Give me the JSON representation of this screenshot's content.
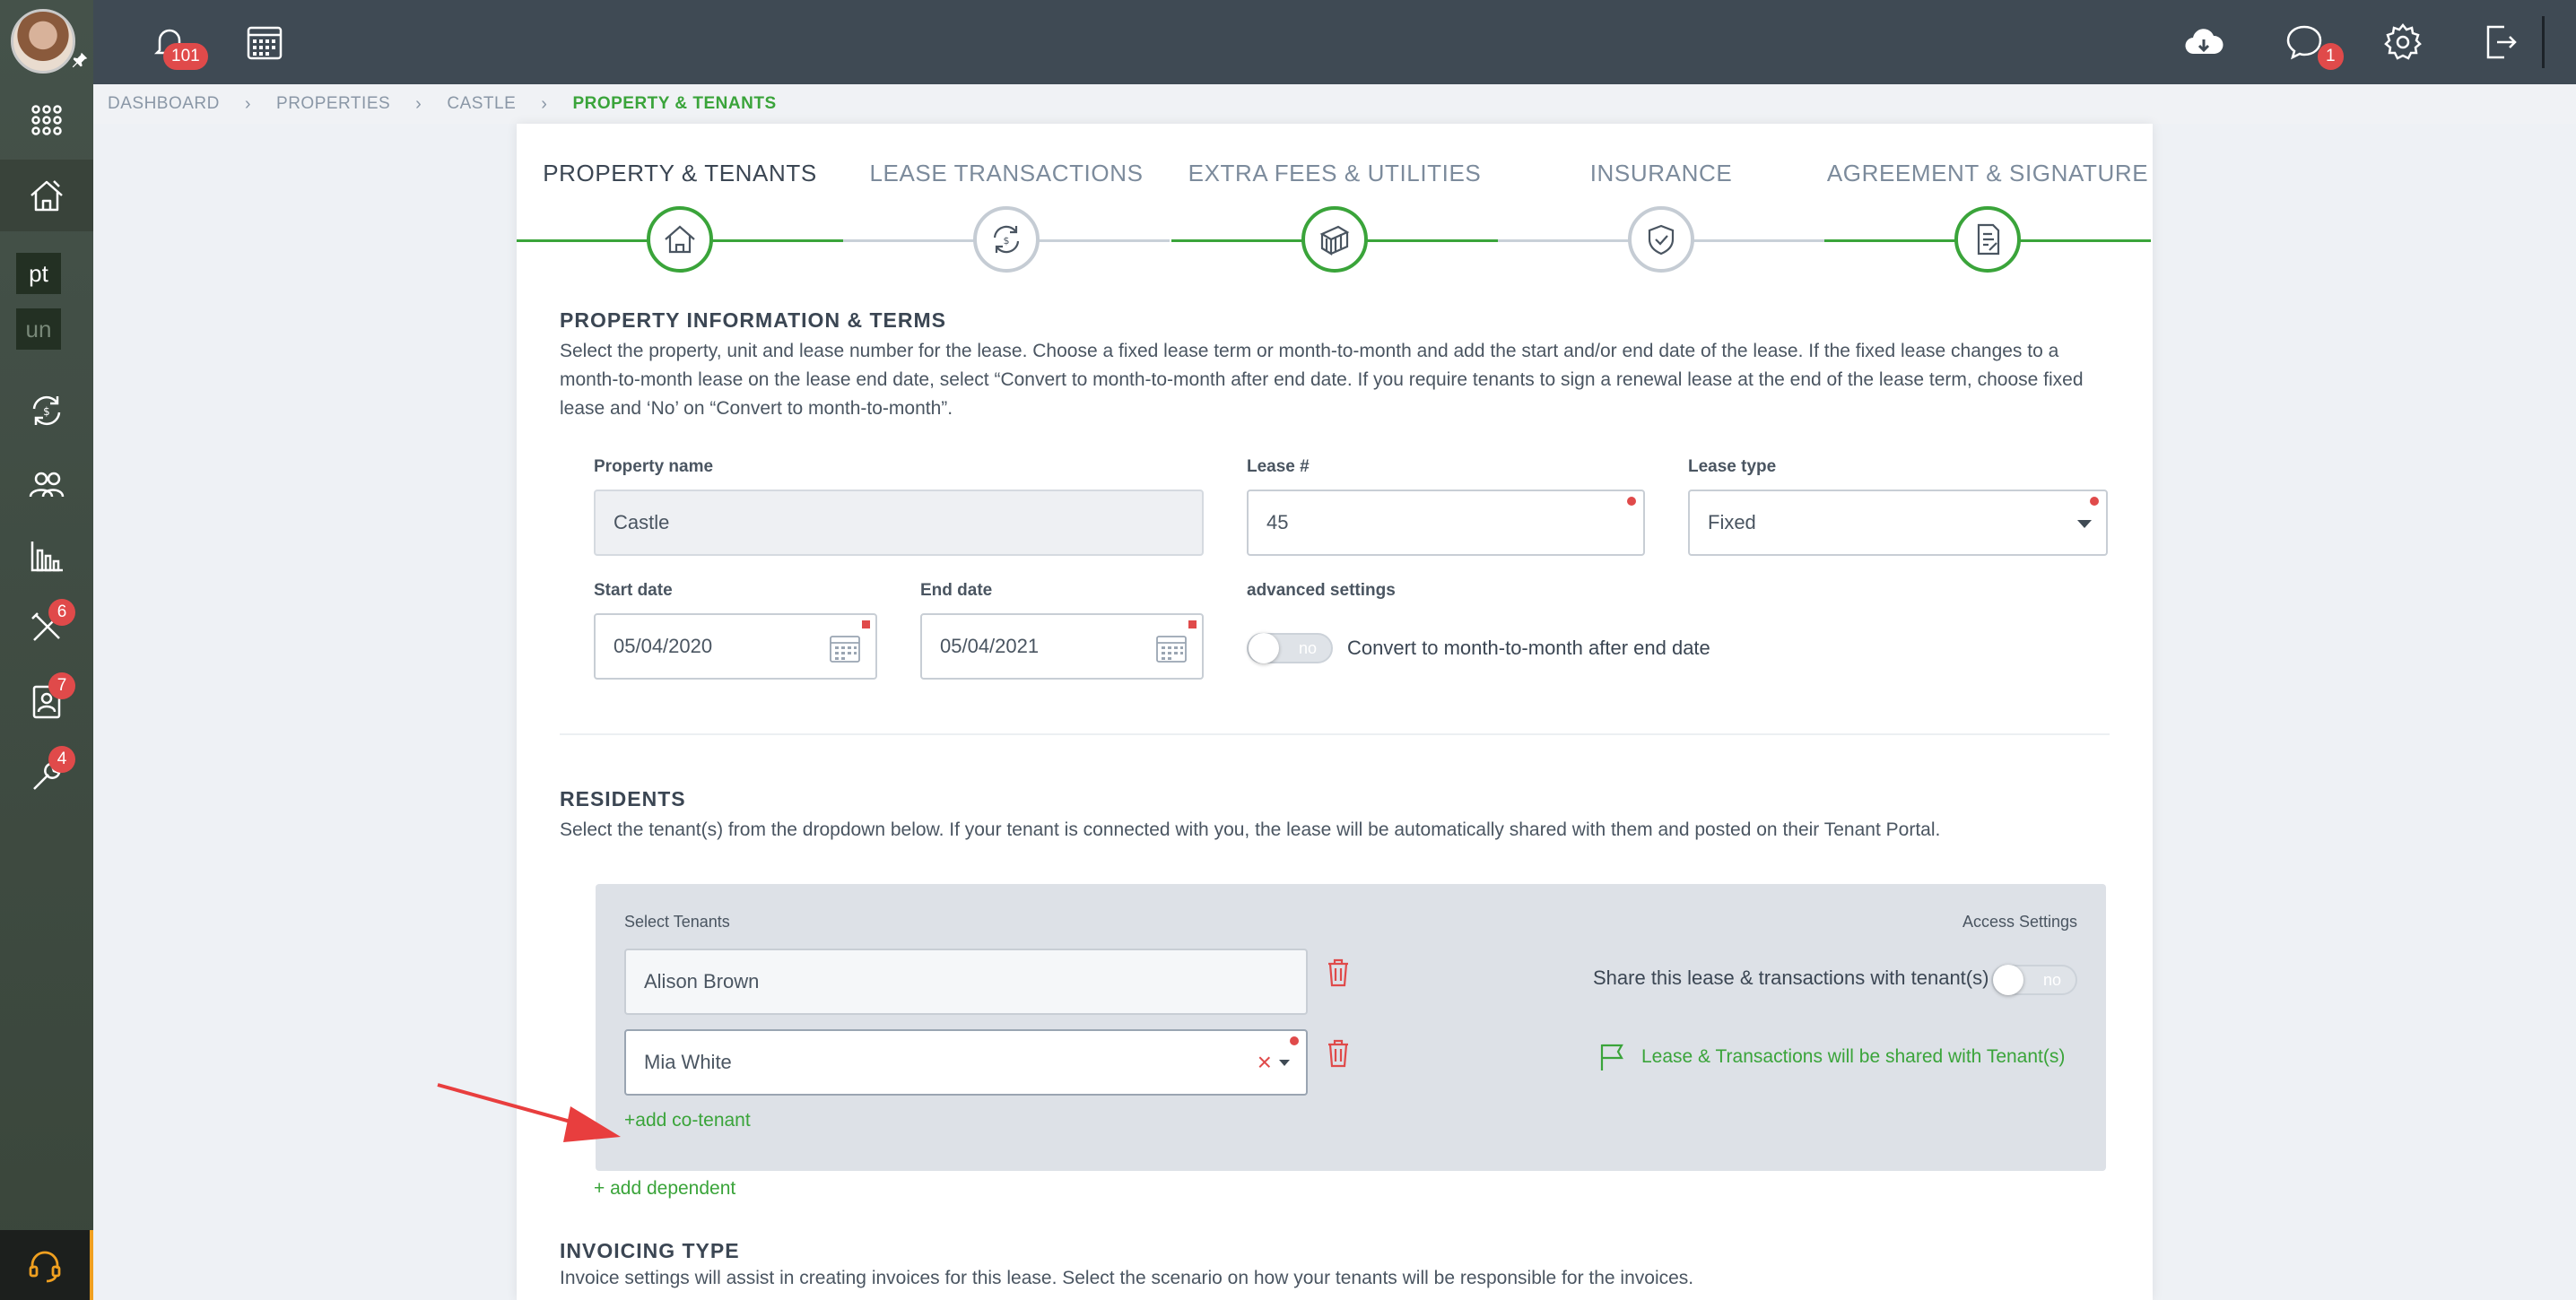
{
  "topbar": {
    "notifications_count": "101",
    "messages_count": "1"
  },
  "sidebar": {
    "chip_pt": "pt",
    "chip_un": "un",
    "badges": {
      "tools": "6",
      "contacts": "7",
      "maintenance": "4"
    }
  },
  "breadcrumb": {
    "items": [
      "DASHBOARD",
      "PROPERTIES",
      "CASTLE",
      "PROPERTY & TENANTS"
    ]
  },
  "steps": [
    {
      "label": "PROPERTY & TENANTS",
      "icon": "house-icon",
      "active": true,
      "done": true
    },
    {
      "label": "LEASE TRANSACTIONS",
      "icon": "refresh-dollar-icon",
      "active": false,
      "done": false
    },
    {
      "label": "EXTRA FEES & UTILITIES",
      "icon": "money-stack-icon",
      "active": false,
      "done": true
    },
    {
      "label": "INSURANCE",
      "icon": "shield-check-icon",
      "active": false,
      "done": false
    },
    {
      "label": "AGREEMENT & SIGNATURE",
      "icon": "document-sign-icon",
      "active": false,
      "done": true
    }
  ],
  "property_section": {
    "title": "PROPERTY INFORMATION & TERMS",
    "description": "Select the property, unit and lease number for the lease. Choose a fixed lease term or month-to-month and add the start and/or end date of the lease. If the fixed lease changes to a month-to-month lease on the lease end date, select “Convert to month-to-month after end date. If you require tenants to sign a renewal lease at the end of the lease term, choose fixed lease and ‘No’ on “Convert to month-to-month”.",
    "property_name_label": "Property name",
    "property_name_value": "Castle",
    "lease_no_label": "Lease #",
    "lease_no_value": "45",
    "lease_type_label": "Lease type",
    "lease_type_value": "Fixed",
    "start_date_label": "Start date",
    "start_date_value": "05/04/2020",
    "end_date_label": "End date",
    "end_date_value": "05/04/2021",
    "advanced_label": "advanced settings",
    "convert_toggle_value": "no",
    "convert_label": "Convert to month-to-month after end date"
  },
  "residents": {
    "title": "RESIDENTS",
    "description": "Select the tenant(s) from the dropdown below. If your tenant is connected with you, the lease will be automatically shared with them and posted on their Tenant Portal.",
    "select_tenants_label": "Select Tenants",
    "access_settings_label": "Access Settings",
    "tenants": [
      "Alison Brown",
      "Mia White"
    ],
    "share_label": "Share this lease & transactions with tenant(s)",
    "share_toggle_value": "no",
    "shared_note": "Lease & Transactions will be shared with Tenant(s)",
    "add_cotenant": "+add co-tenant",
    "add_dependent": "+ add dependent"
  },
  "invoicing": {
    "title": "INVOICING TYPE",
    "description": "Invoice settings will assist in creating invoices for this lease. Select the scenario on how your tenants will be responsible for the invoices."
  },
  "colors": {
    "accent": "#3aa43a",
    "badge": "#e04a4a",
    "topbar": "#3f4a54",
    "sidebar": "#3e4a3e"
  }
}
